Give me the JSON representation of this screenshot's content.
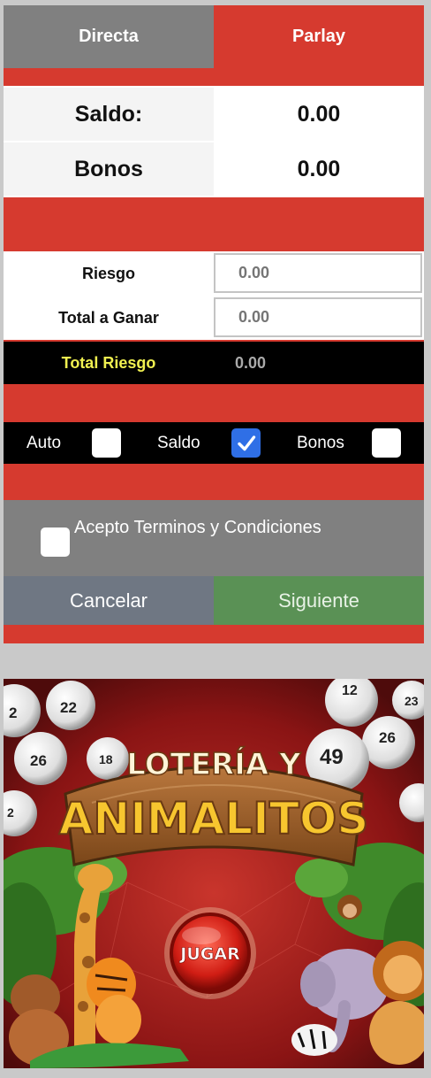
{
  "tabs": {
    "directa": "Directa",
    "parlay": "Parlay"
  },
  "balances": {
    "saldo_label": "Saldo:",
    "saldo_value": "0.00",
    "bonos_label": "Bonos",
    "bonos_value": "0.00"
  },
  "risk": {
    "riesgo_label": "Riesgo",
    "riesgo_placeholder": "0.00",
    "total_ganar_label": "Total a Ganar",
    "total_ganar_placeholder": "0.00",
    "total_riesgo_label": "Total Riesgo",
    "total_riesgo_value": "0.00"
  },
  "options": {
    "auto_label": "Auto",
    "auto_checked": false,
    "saldo_label": "Saldo",
    "saldo_checked": true,
    "bonos_label": "Bonos",
    "bonos_checked": false
  },
  "terms": {
    "label": "Acepto Terminos y Condiciones",
    "checked": false
  },
  "actions": {
    "cancel": "Cancelar",
    "next": "Siguiente"
  },
  "banner": {
    "title_line1": "LOTERÍA Y",
    "title_line2": "ANIMALITOS",
    "play_button": "JUGAR",
    "balls": [
      "2",
      "22",
      "26",
      "18",
      "12",
      "23",
      "26",
      "49",
      "2"
    ],
    "colors": {
      "accent_red": "#d63a2f",
      "tab_gray": "#808080",
      "next_green": "#5a9155",
      "cancel_gray": "#6f7783",
      "total_yellow": "#f0f050",
      "check_blue": "#2f6fe6"
    }
  }
}
